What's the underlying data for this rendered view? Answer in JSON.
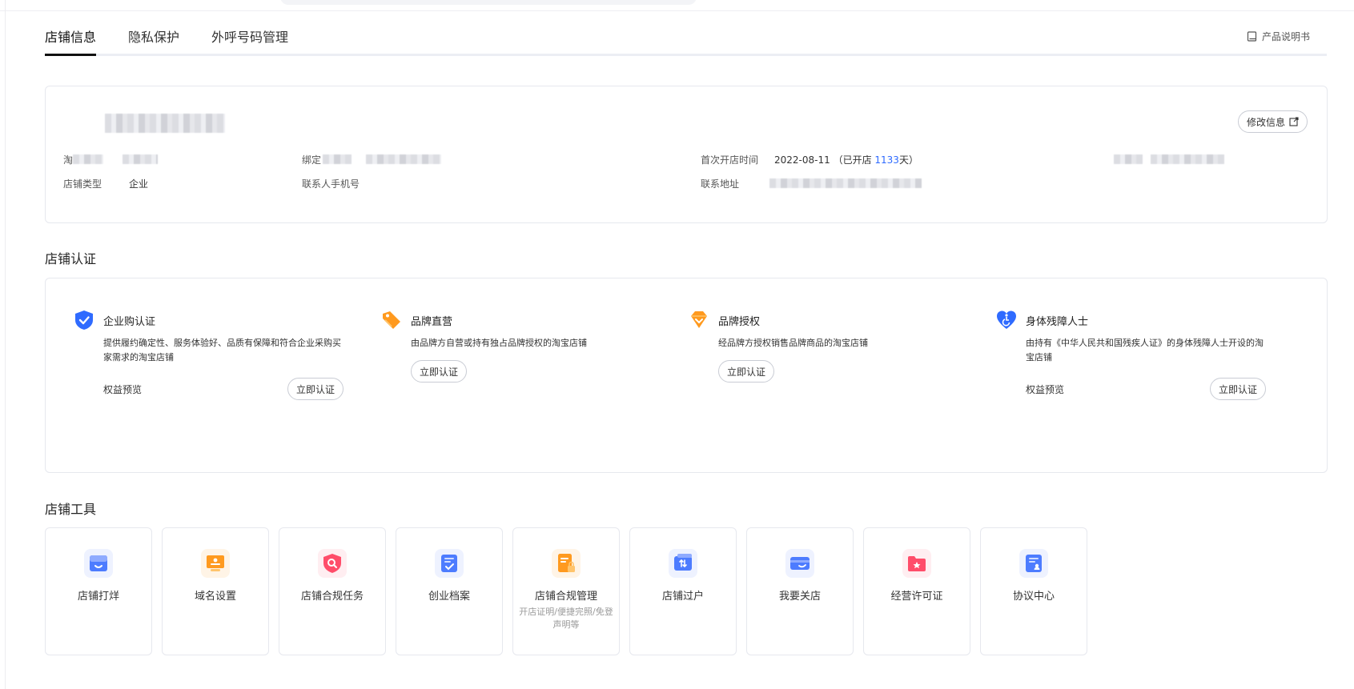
{
  "tabs": [
    {
      "label": "店铺信息",
      "active": true
    },
    {
      "label": "隐私保护",
      "active": false
    },
    {
      "label": "外呼号码管理",
      "active": false
    }
  ],
  "manual_link": "产品说明书",
  "shop_info": {
    "edit_label": "修改信息",
    "row1": {
      "label1": "淘",
      "label2": "绑定",
      "open_time_label": "首次开店时间",
      "open_date": "2022-08-11",
      "open_prefix": "（已开店 ",
      "open_days": "1133",
      "open_suffix": "天）"
    },
    "row2": {
      "type_label": "店铺类型",
      "type_value": "企业",
      "phone_label": "联系人手机号",
      "address_label": "联系地址"
    }
  },
  "cert_section_title": "店铺认证",
  "certs": [
    {
      "name": "企业购认证",
      "desc": "提供履约确定性、服务体验好、品质有保障和符合企业采购买家需求的淘宝店铺",
      "benefit": "权益预览",
      "button": "立即认证",
      "icon": "shield-check-icon",
      "color": "#2f6bff"
    },
    {
      "name": "品牌直营",
      "desc": "由品牌方自营或持有独占品牌授权的淘宝店铺",
      "button": "立即认证",
      "icon": "tag-icon",
      "color": "#ff9a1f"
    },
    {
      "name": "品牌授权",
      "desc": "经品牌方授权销售品牌商品的淘宝店铺",
      "button": "立即认证",
      "icon": "diamond-icon",
      "color": "#ff9a1f"
    },
    {
      "name": "身体残障人士",
      "desc": "由持有《中华人民共和国残疾人证》的身体残障人士开设的淘宝店铺",
      "benefit": "权益预览",
      "button": "立即认证",
      "icon": "heart-accessible-icon",
      "color": "#2f6bff"
    }
  ],
  "tools_section_title": "店铺工具",
  "tools": [
    {
      "name": "店铺打烊",
      "icon": "shop-close-icon",
      "color": "#4d7cff"
    },
    {
      "name": "域名设置",
      "icon": "domain-icon",
      "color": "#ff9a1f"
    },
    {
      "name": "店铺合规任务",
      "icon": "compliance-shield-icon",
      "color": "#ff4d6a"
    },
    {
      "name": "创业档案",
      "icon": "archive-icon",
      "color": "#4d7cff"
    },
    {
      "name": "店铺合规管理",
      "sub": "开店证明/便捷完照/免登声明等",
      "icon": "document-lock-icon",
      "color": "#ff9a1f"
    },
    {
      "name": "店铺过户",
      "icon": "transfer-card-icon",
      "color": "#4d7cff"
    },
    {
      "name": "我要关店",
      "icon": "close-shop-card-icon",
      "color": "#4d7cff"
    },
    {
      "name": "经营许可证",
      "icon": "license-folder-icon",
      "color": "#ff4d6a"
    },
    {
      "name": "协议中心",
      "icon": "agreement-icon",
      "color": "#4d7cff"
    }
  ]
}
